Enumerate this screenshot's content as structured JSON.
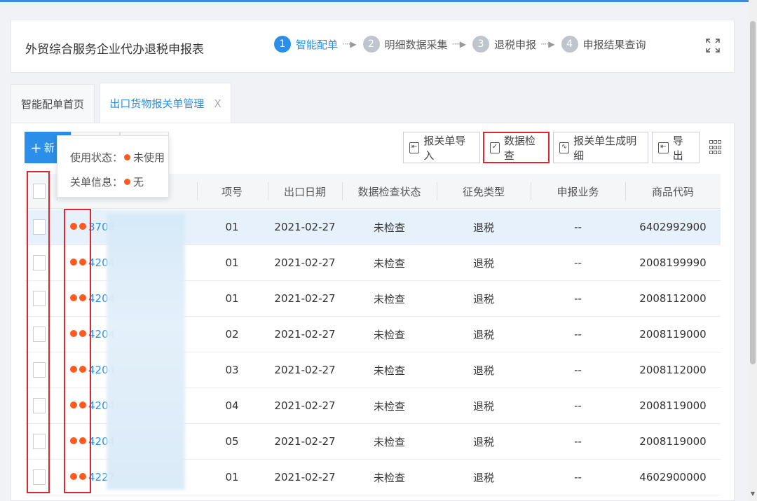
{
  "header": {
    "title": "外贸综合服务企业代办退税申报表",
    "steps": [
      {
        "num": "1",
        "label": "智能配单",
        "active": true
      },
      {
        "num": "2",
        "label": "明细数据采集",
        "active": false
      },
      {
        "num": "3",
        "label": "退税申报",
        "active": false
      },
      {
        "num": "4",
        "label": "申报结果查询",
        "active": false
      }
    ],
    "step_arrow": "····▶",
    "expand_glyph": "↖↗↙↘"
  },
  "tabs": {
    "home": "智能配单首页",
    "active": "出口货物报关单管理",
    "close": "X"
  },
  "toolbar": {
    "new_plus": "+",
    "new_label": "新",
    "import_label": "报关单导入",
    "check_label": "数据检查",
    "generate_label": "报关单生成明细",
    "export_label": "导出"
  },
  "tooltip": {
    "status_label": "使用状态：",
    "status_value": "未使用",
    "info_label": "关单信息：",
    "info_value": "无"
  },
  "table": {
    "columns": [
      "项号",
      "出口日期",
      "数据检查状态",
      "征免类型",
      "申报业务",
      "商品代码"
    ],
    "rows": [
      {
        "id": "3708",
        "item": "01",
        "date": "2021-02-27",
        "status": "未检查",
        "type": "退税",
        "business": "--",
        "code": "6402992900"
      },
      {
        "id": "4204",
        "item": "01",
        "date": "2021-02-27",
        "status": "未检查",
        "type": "退税",
        "business": "--",
        "code": "2008199990"
      },
      {
        "id": "4204",
        "item": "01",
        "date": "2021-02-27",
        "status": "未检查",
        "type": "退税",
        "business": "--",
        "code": "2008112000"
      },
      {
        "id": "4204",
        "item": "02",
        "date": "2021-02-27",
        "status": "未检查",
        "type": "退税",
        "business": "--",
        "code": "2008119000"
      },
      {
        "id": "4204",
        "item": "03",
        "date": "2021-02-27",
        "status": "未检查",
        "type": "退税",
        "business": "--",
        "code": "2008112000"
      },
      {
        "id": "4204",
        "item": "04",
        "date": "2021-02-27",
        "status": "未检查",
        "type": "退税",
        "business": "--",
        "code": "2008119000"
      },
      {
        "id": "4204",
        "item": "05",
        "date": "2021-02-27",
        "status": "未检查",
        "type": "退税",
        "business": "--",
        "code": "2008119000"
      },
      {
        "id": "4227",
        "item": "01",
        "date": "2021-02-27",
        "status": "未检查",
        "type": "退税",
        "business": "--",
        "code": "4602900000"
      }
    ]
  },
  "colors": {
    "accent": "#2b8ee8",
    "status_dot": "#ff5a1f",
    "highlight": "#d9282f"
  }
}
